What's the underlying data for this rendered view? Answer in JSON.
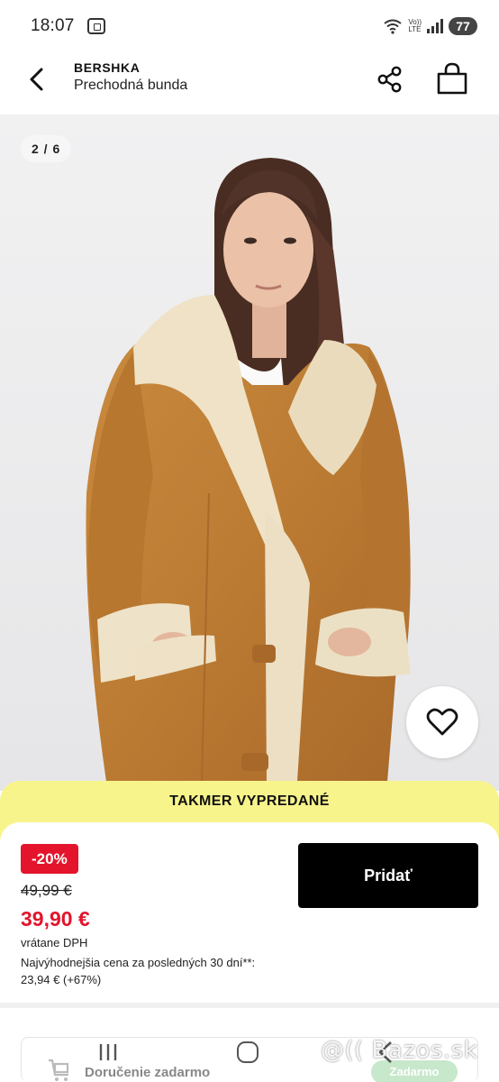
{
  "status_bar": {
    "time": "18:07",
    "network_top": "5",
    "network_bottom": "LTE",
    "volte": "Vo))",
    "battery": "77"
  },
  "header": {
    "brand": "BERSHKA",
    "title": "Prechodná bunda"
  },
  "gallery": {
    "counter": "2 / 6"
  },
  "banner": {
    "text": "TAKMER VYPREDANÉ"
  },
  "price": {
    "discount": "-20%",
    "old_price": "49,99 €",
    "new_price": "39,90 €",
    "vat_note": "vrátane DPH",
    "lowest_label": "Najvýhodnejšia cena za posledných 30 dní**:",
    "lowest_value": "23,94 € (+67%)"
  },
  "actions": {
    "add_label": "Pridať"
  },
  "delivery": {
    "text": "Doručenie zadarmo",
    "badge": "Zadarmo"
  },
  "watermark": "@(( Bazos.sk",
  "colors": {
    "discount_red": "#e3142c",
    "banner_yellow": "#f8f48c",
    "button_black": "#000000"
  }
}
